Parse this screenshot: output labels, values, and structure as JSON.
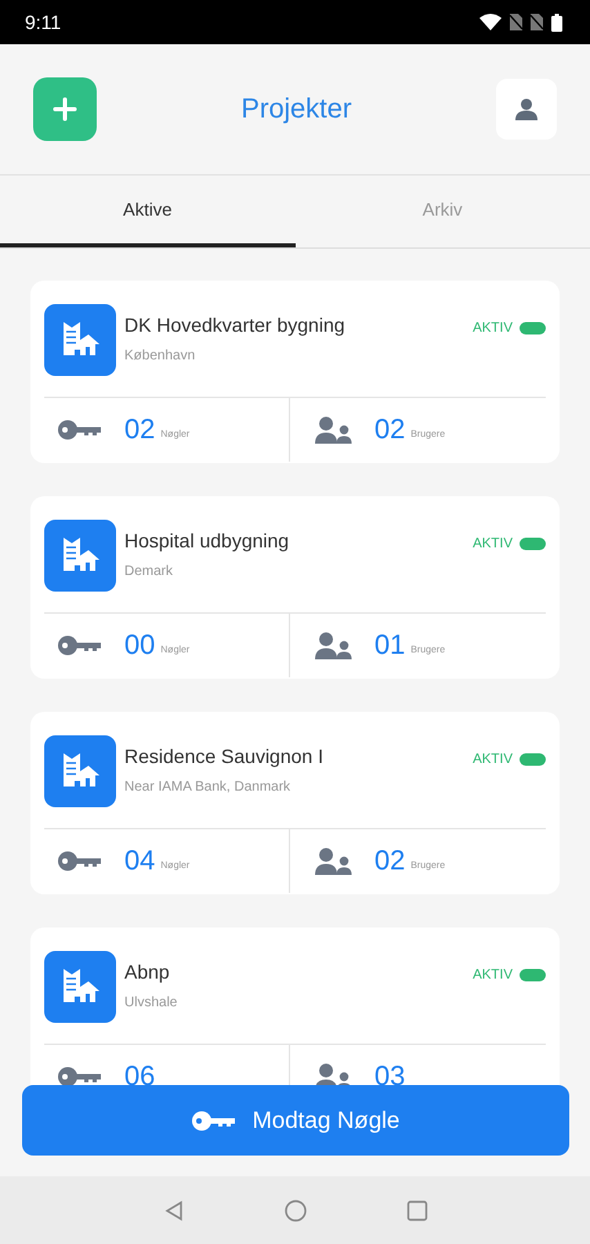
{
  "status_bar": {
    "time": "9:11"
  },
  "header": {
    "title": "Projekter"
  },
  "tabs": [
    {
      "label": "Aktive",
      "selected": true
    },
    {
      "label": "Arkiv",
      "selected": false
    }
  ],
  "projects": [
    {
      "name": "DK Hovedkvarter bygning",
      "location": "København",
      "status": "AKTIV",
      "active": true,
      "keys": "02",
      "keys_label": "Nøgler",
      "users": "02",
      "users_label": "Brugere"
    },
    {
      "name": "Hospital udbygning",
      "location": "Demark",
      "status": "AKTIV",
      "active": true,
      "keys": "00",
      "keys_label": "Nøgler",
      "users": "01",
      "users_label": "Brugere"
    },
    {
      "name": "Residence Sauvignon I",
      "location": "Near IAMA Bank, Danmark",
      "status": "AKTIV",
      "active": true,
      "keys": "04",
      "keys_label": "Nøgler",
      "users": "02",
      "users_label": "Brugere"
    },
    {
      "name": "Abnp",
      "location": "Ulvshale",
      "status": "AKTIV",
      "active": true,
      "keys": "06",
      "users": "03"
    }
  ],
  "receive_button": {
    "label": "Modtag Nøgle"
  }
}
